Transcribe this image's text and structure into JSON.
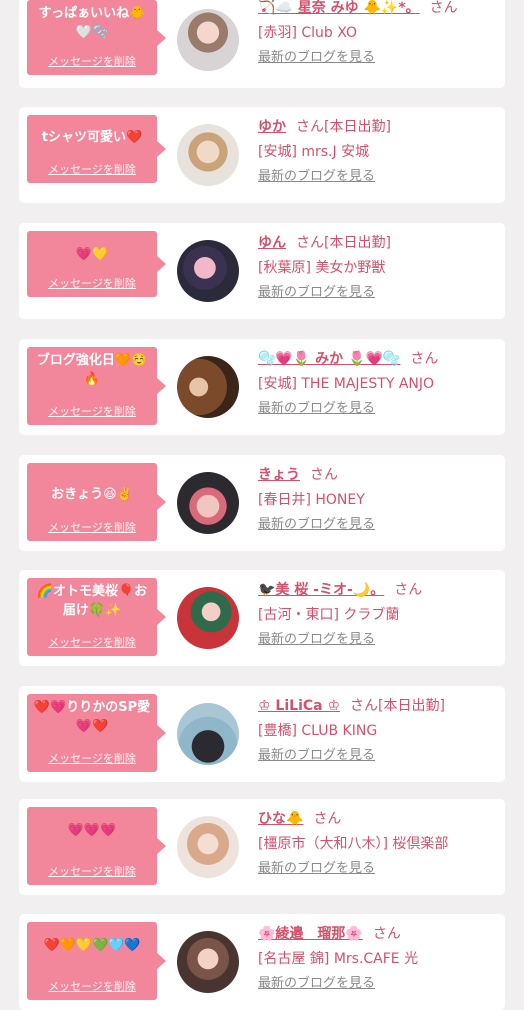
{
  "delete_label": "メッセージを削除",
  "blog_label": "最新のブログを見る",
  "san_label": "さん",
  "entries": [
    {
      "message": "すっぱぁいいね🐥🤍🫧",
      "name": "🏹☁️ 星奈 みゆ 🐥✨*。",
      "status": "",
      "shop": "[赤羽] Club XO"
    },
    {
      "message": "tシャツ可愛い❤️",
      "name": "ゆか",
      "status": "[本日出勤]",
      "shop": "[安城] mrs.J 安城"
    },
    {
      "message": "💗💛",
      "name": "ゆん",
      "status": "[本日出勤]",
      "shop": "[秋葉原] 美女か野獣"
    },
    {
      "message": "ブログ強化日🧡☺️🔥",
      "name": "🫧💗🌷 みか 🌷💗🫧",
      "status": "",
      "shop": "[安城] THE MAJESTY ANJO"
    },
    {
      "message": "おきょう😆✌️",
      "name": "きょう",
      "status": "",
      "shop": "[春日井] HONEY"
    },
    {
      "message": "🌈オトモ美桜🎈お届け🍀✨",
      "name": "🐦‍⬛美 桜 -ミオ-🌙。",
      "status": "",
      "shop": "[古河・東口] クラブ蘭"
    },
    {
      "message": "❤️💗りりかのSP愛💗❤️",
      "name": "♔ LiLiCa ♔",
      "status": "[本日出勤]",
      "shop": "[豊橋] CLUB KING"
    },
    {
      "message": "💗💗💗",
      "name": "ひな🐥",
      "status": "",
      "shop": "[橿原市（大和八木）] 桜倶楽部"
    },
    {
      "message": "❤️🧡💛💚🩵💙",
      "name": "🌸綾邉　瑠那🌸",
      "status": "",
      "shop": "[名古屋 錦] Mrs.CAFE 光"
    }
  ],
  "colors": {
    "accent": "#d5516b",
    "bubble": "#f2869a",
    "background": "#f2eff0",
    "link_gray": "#8a8a8a"
  }
}
